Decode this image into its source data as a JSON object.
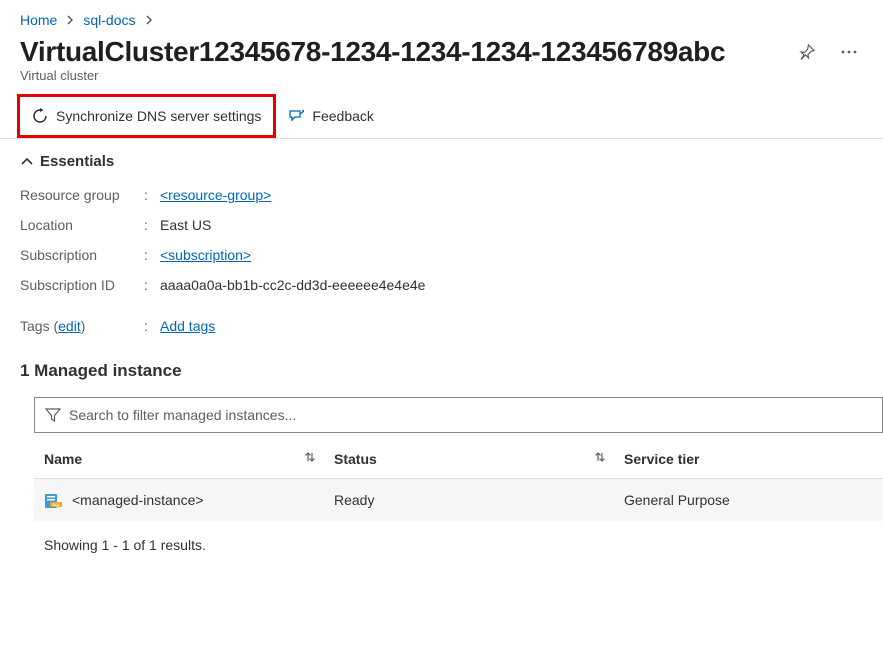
{
  "breadcrumb": {
    "home": "Home",
    "parent": "sql-docs"
  },
  "header": {
    "title": "VirtualCluster12345678-1234-1234-1234-123456789abc",
    "subtitle": "Virtual cluster"
  },
  "toolbar": {
    "sync_label": "Synchronize DNS server settings",
    "feedback_label": "Feedback"
  },
  "essentials": {
    "heading": "Essentials",
    "resource_group_key": "Resource group",
    "resource_group_val": "<resource-group>",
    "location_key": "Location",
    "location_val": "East US",
    "subscription_key": "Subscription",
    "subscription_val": "<subscription>",
    "subscription_id_key": "Subscription ID",
    "subscription_id_val": "aaaa0a0a-bb1b-cc2c-dd3d-eeeeee4e4e4e",
    "tags_key": "Tags",
    "tags_edit": "edit",
    "tags_add": "Add tags"
  },
  "section": {
    "title": "1 Managed instance",
    "search_placeholder": "Search to filter managed instances...",
    "col_name": "Name",
    "col_status": "Status",
    "col_tier": "Service tier",
    "rows": [
      {
        "name": "<managed-instance>",
        "status": "Ready",
        "tier": "General Purpose"
      }
    ],
    "results": "Showing 1 - 1 of 1 results."
  }
}
